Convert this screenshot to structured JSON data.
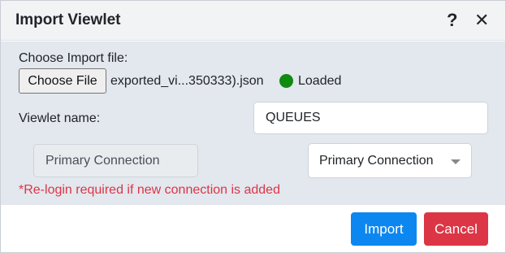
{
  "dialog": {
    "title": "Import Viewlet",
    "help_glyph": "?",
    "close_glyph": "✕",
    "icons": {
      "help": "help-icon",
      "close": "close-icon"
    }
  },
  "form": {
    "file_label": "Choose Import file:",
    "choose_button": "Choose File",
    "file_name": "exported_vi...350333).json",
    "status_text": "Loaded",
    "status_color": "#108a10",
    "name_label": "Viewlet name:",
    "name_value": "QUEUES",
    "readonly_connection": "Primary Connection",
    "selected_connection": "Primary Connection",
    "warning": "*Re-login required if new connection is added",
    "warning_color": "#dc3545"
  },
  "footer": {
    "import_label": "Import",
    "cancel_label": "Cancel",
    "import_color": "#0d87f0",
    "cancel_color": "#dc3545"
  }
}
